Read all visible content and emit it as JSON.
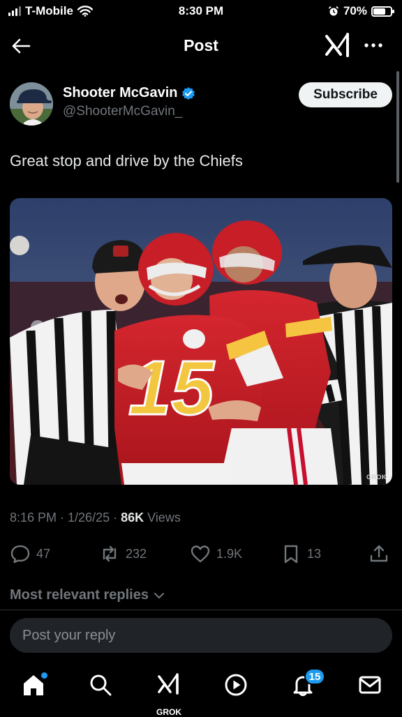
{
  "status_bar": {
    "carrier": "T-Mobile",
    "time": "8:30 PM",
    "battery": "70%",
    "battery_level": 0.7,
    "icons": [
      "signal-icon",
      "wifi-icon",
      "alarm-icon",
      "battery-icon"
    ]
  },
  "nav": {
    "title": "Post",
    "back_icon": "arrow-left-icon",
    "grok_icon": "xai-grok-icon",
    "more_icon": "more-horizontal-icon"
  },
  "post": {
    "author_name": "Shooter McGavin",
    "author_handle": "@ShooterMcGavin_",
    "verified": true,
    "subscribe_label": "Subscribe",
    "text": "Great stop and drive by the Chiefs",
    "image_watermark": "GROK",
    "timestamp": "8:16 PM · 1/26/25 · ",
    "views_count": "86K",
    "views_label": " Views"
  },
  "actions": {
    "replies": "47",
    "reposts": "232",
    "likes": "1.9K",
    "bookmarks": "13",
    "icons": [
      "reply-icon",
      "repost-icon",
      "like-icon",
      "bookmark-icon",
      "share-icon"
    ]
  },
  "replies_sort": "Most relevant replies",
  "reply_placeholder": "Post your reply",
  "bottom_nav": {
    "items": [
      "home-icon",
      "search-icon",
      "grok-icon",
      "video-icon",
      "notifications-icon",
      "messages-icon"
    ],
    "grok_label": "GROK",
    "notifications_count": "15"
  },
  "colors": {
    "accent": "#1d9bf0",
    "background": "#000000",
    "secondary_text": "#71767b"
  }
}
